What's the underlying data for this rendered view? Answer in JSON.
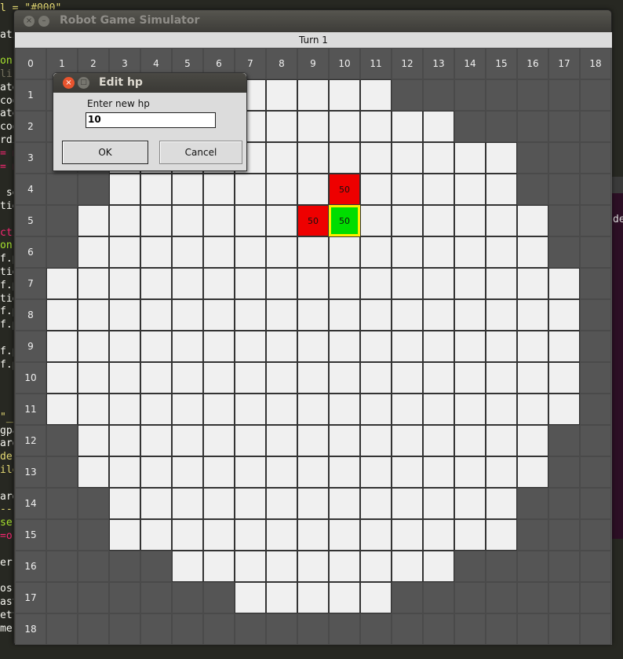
{
  "editor": {
    "lines": [
      {
        "text": "l = \"#000\"",
        "cls": "str"
      },
      {
        "text": "",
        "cls": ""
      },
      {
        "text": "atio",
        "cls": ""
      },
      {
        "text": "",
        "cls": ""
      },
      {
        "text": "on(",
        "cls": "fn"
      },
      {
        "text": "lis",
        "cls": "dim"
      },
      {
        "text": "ate",
        "cls": ""
      },
      {
        "text": "coo",
        "cls": ""
      },
      {
        "text": "ate",
        "cls": ""
      },
      {
        "text": "coo",
        "cls": ""
      },
      {
        "text": "rdi",
        "cls": ""
      },
      {
        "text": "= n",
        "cls": "key"
      },
      {
        "text": "= n",
        "cls": "key"
      },
      {
        "text": "",
        "cls": ""
      },
      {
        "text": " se",
        "cls": ""
      },
      {
        "text": "tio",
        "cls": ""
      },
      {
        "text": "",
        "cls": ""
      },
      {
        "text": "cti",
        "cls": "key"
      },
      {
        "text": "on(",
        "cls": "fn"
      },
      {
        "text": "f.p",
        "cls": ""
      },
      {
        "text": "tio",
        "cls": ""
      },
      {
        "text": "f.p",
        "cls": ""
      },
      {
        "text": "tio",
        "cls": ""
      },
      {
        "text": "f.p",
        "cls": ""
      },
      {
        "text": "f.p",
        "cls": ""
      },
      {
        "text": "",
        "cls": ""
      },
      {
        "text": "f.p",
        "cls": ""
      },
      {
        "text": "f.p",
        "cls": ""
      },
      {
        "text": "",
        "cls": ""
      },
      {
        "text": "",
        "cls": ""
      },
      {
        "text": "",
        "cls": ""
      },
      {
        "text": "\"__",
        "cls": "str"
      },
      {
        "text": "gpa",
        "cls": ""
      },
      {
        "text": "arg",
        "cls": ""
      },
      {
        "text": "de'",
        "cls": "str"
      },
      {
        "text": "ile",
        "cls": "str"
      },
      {
        "text": "",
        "cls": ""
      },
      {
        "text": "arg",
        "cls": ""
      },
      {
        "text": "--r",
        "cls": "str"
      },
      {
        "text": "ser",
        "cls": "fn"
      },
      {
        "text": "=os",
        "cls": "key"
      },
      {
        "text": "",
        "cls": ""
      },
      {
        "text": "er ",
        "cls": ""
      },
      {
        "text": "",
        "cls": ""
      },
      {
        "text": "os",
        "cls": ""
      },
      {
        "text": "ast",
        "cls": ""
      },
      {
        "text": "ett",
        "cls": ""
      },
      {
        "text": "me.Player(open(args.usercode).read())",
        "cls": ""
      }
    ],
    "side_text": "de"
  },
  "window": {
    "title": "Robot Game Simulator",
    "close_glyph": "×",
    "min_glyph": "–",
    "turn_label": "Turn 1"
  },
  "board": {
    "columns": [
      "0",
      "1",
      "2",
      "3",
      "4",
      "5",
      "6",
      "7",
      "8",
      "9",
      "10",
      "11",
      "12",
      "13",
      "14",
      "15",
      "16",
      "17",
      "18"
    ],
    "rows": [
      "1",
      "2",
      "3",
      "4",
      "5",
      "6",
      "7",
      "8",
      "9",
      "10",
      "11",
      "12",
      "13",
      "14",
      "15",
      "16",
      "17",
      "18"
    ],
    "floor_ranges": [
      [
        7,
        11
      ],
      [
        5,
        13
      ],
      [
        3,
        15
      ],
      [
        3,
        15
      ],
      [
        2,
        16
      ],
      [
        2,
        16
      ],
      [
        1,
        17
      ],
      [
        1,
        17
      ],
      [
        1,
        17
      ],
      [
        1,
        17
      ],
      [
        1,
        17
      ],
      [
        2,
        16
      ],
      [
        2,
        16
      ],
      [
        3,
        15
      ],
      [
        3,
        15
      ],
      [
        5,
        13
      ],
      [
        7,
        11
      ],
      null
    ],
    "robots": [
      {
        "x": 10,
        "y": 4,
        "hp": "50",
        "team": "enemy",
        "color": "#ee0000"
      },
      {
        "x": 9,
        "y": 5,
        "hp": "50",
        "team": "enemy",
        "color": "#ee0000"
      },
      {
        "x": 10,
        "y": 5,
        "hp": "50",
        "team": "player",
        "color": "#00dd00",
        "selected": true
      }
    ]
  },
  "dialog": {
    "title": "Edit hp",
    "close_glyph": "×",
    "max_glyph": "□",
    "prompt": "Enter new hp",
    "input_value": "10",
    "ok_label": "OK",
    "cancel_label": "Cancel"
  }
}
